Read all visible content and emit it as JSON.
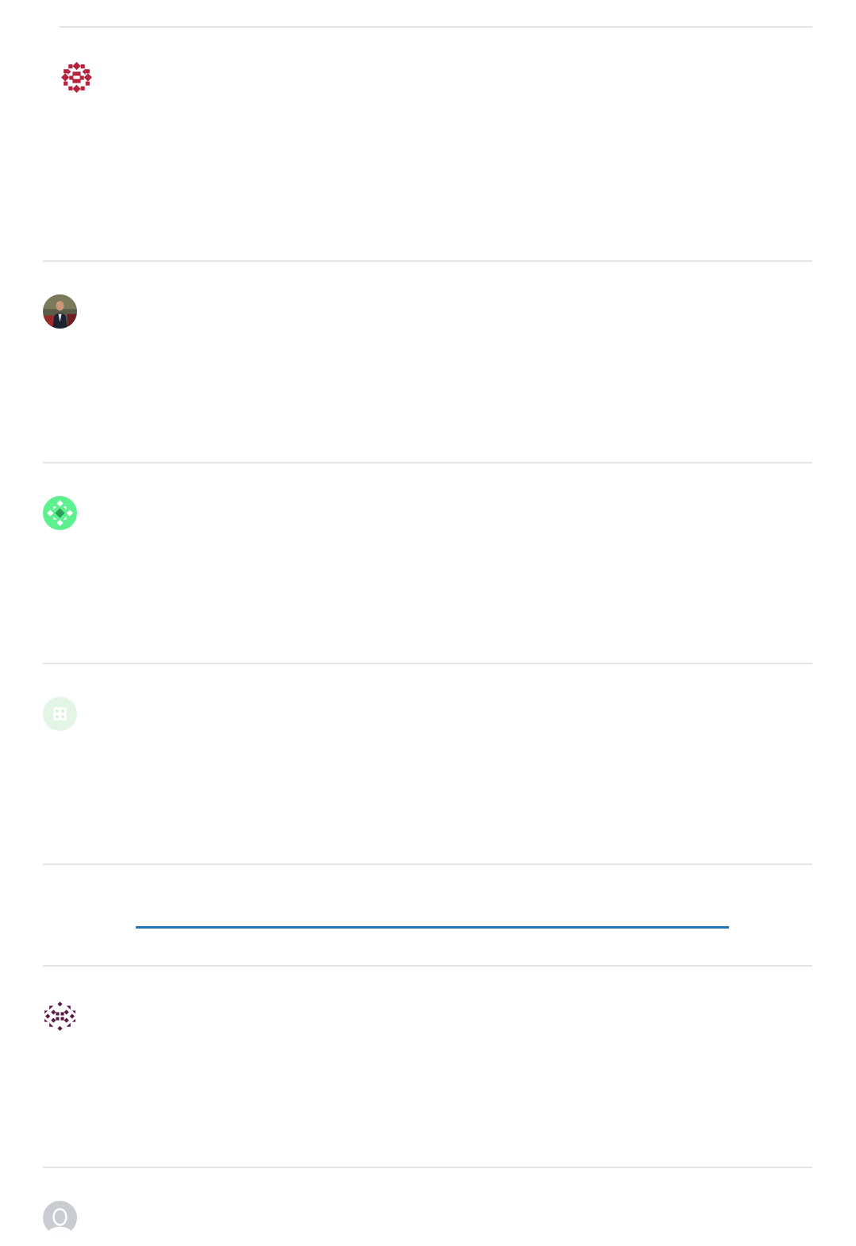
{
  "comments": [
    {
      "avatar_icon": "geometric-identicon",
      "avatar_color": "#b5223c"
    },
    {
      "avatar_icon": "user-photo",
      "avatar_color": "#3d4a3a"
    },
    {
      "avatar_icon": "geometric-identicon",
      "avatar_color": "#5cf18e"
    },
    {
      "avatar_icon": "geometric-identicon",
      "avatar_color": "#e3f6e6"
    },
    {
      "avatar_icon": "geometric-identicon",
      "avatar_color": "#5b1a4a"
    },
    {
      "avatar_icon": "default-user-silhouette",
      "avatar_color": "#c9ccd0"
    }
  ],
  "load_more": {
    "label": "",
    "color": "#1f73b7"
  }
}
